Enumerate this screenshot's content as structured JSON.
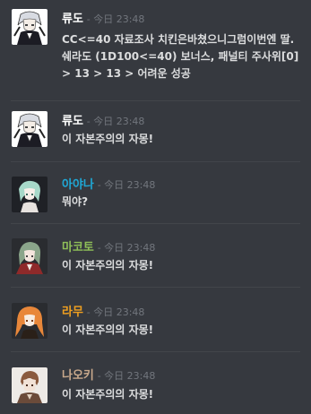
{
  "messages": [
    {
      "author": "류도",
      "author_color": "#ffffff",
      "timestamp": "- 今日 23:48",
      "content": "CC<=40  자료조사 치킨은바쳤으니그럼이번엔 딸.쉐라도 (1D100<=40) 보너스, 패널티 주사위[0] > 13 > 13 > 어려운 성공",
      "avatar_icon": "anime-character-avatar-white-hair"
    },
    {
      "author": "류도",
      "author_color": "#ffffff",
      "timestamp": "- 今日 23:48",
      "content": "이 자본주의의 자몽!",
      "avatar_icon": "anime-character-avatar-white-hair"
    },
    {
      "author": "아야나",
      "author_color": "#1fa8d6",
      "timestamp": "- 今日 23:48",
      "content": "뭐야?",
      "avatar_icon": "anime-character-avatar-green-hair"
    },
    {
      "author": "마코토",
      "author_color": "#8fbf58",
      "timestamp": "- 今日 23:48",
      "content": "이 자본주의의 자몽!",
      "avatar_icon": "anime-character-avatar-green-hair-red-coat"
    },
    {
      "author": "라무",
      "author_color": "#f0a020",
      "timestamp": "- 今日 23:48",
      "content": "이 자본주의의 자몽!",
      "avatar_icon": "anime-character-avatar-orange-hair"
    },
    {
      "author": "나오키",
      "author_color": "#c9a98c",
      "timestamp": "- 今日 23:48",
      "content": "이 자본주의의 자몽!",
      "avatar_icon": "anime-character-avatar-brown-hair"
    }
  ]
}
